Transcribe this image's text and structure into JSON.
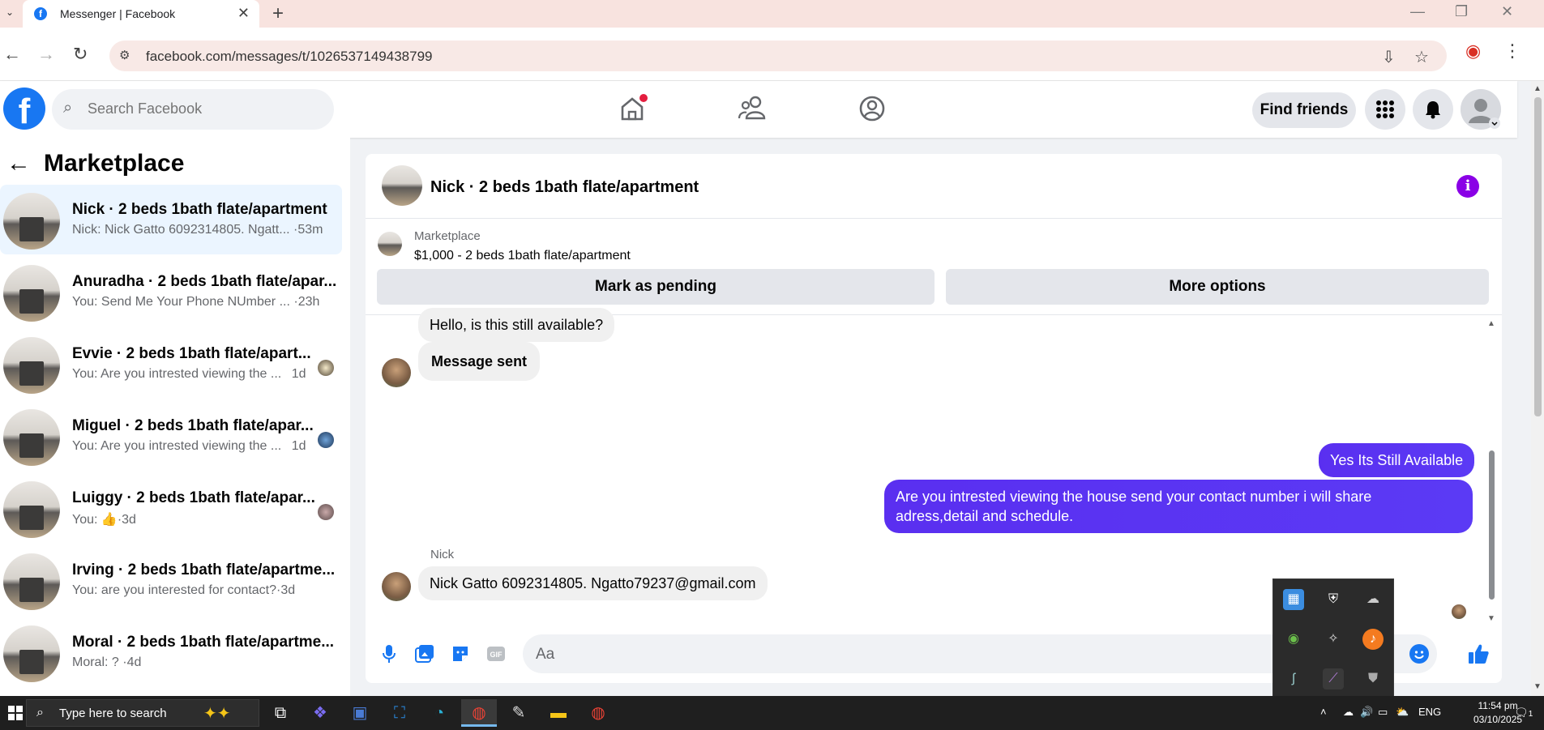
{
  "browser": {
    "tab_title": "Messenger | Facebook",
    "url": "facebook.com/messages/t/1026537149438799",
    "new_tab": "+",
    "close_tab": "✕"
  },
  "fb": {
    "search_placeholder": "Search Facebook",
    "find_friends": "Find friends",
    "colors": {
      "brand": "#1877f2",
      "outgoing_bubble": "#5b38f6",
      "info_accent": "#8a00e6"
    }
  },
  "sidebar": {
    "title": "Marketplace",
    "conversations": [
      {
        "name": "Nick · 2 beds 1bath flate/apartment",
        "preview": "Nick: Nick Gatto 6092314805. Ngatt...",
        "time": "·53m",
        "active": true
      },
      {
        "name": "Anuradha · 2 beds 1bath flate/apar...",
        "preview": "You: Send Me Your Phone NUmber ...",
        "time": "·23h",
        "active": false
      },
      {
        "name": "Evvie · 2 beds 1bath flate/apart...",
        "preview": "You: Are you intrested viewing the ...",
        "time": "1d",
        "active": false
      },
      {
        "name": "Miguel · 2 beds 1bath flate/apar...",
        "preview": "You: Are you intrested viewing the ...",
        "time": "1d",
        "active": false
      },
      {
        "name": "Luiggy · 2 beds 1bath flate/apar...",
        "preview": "You:",
        "time": "·3d",
        "active": false
      },
      {
        "name": "Irving · 2 beds 1bath flate/apartme...",
        "preview": "You: are you interested for contact?",
        "time": "·3d",
        "active": false
      },
      {
        "name": "Moral · 2 beds 1bath flate/apartme...",
        "preview": "Moral: ?",
        "time": "·4d",
        "active": false
      }
    ]
  },
  "chat": {
    "title": "Nick · 2 beds 1bath flate/apartment",
    "marketplace_label": "Marketplace",
    "listing": "$1,000 - 2 beds 1bath flate/apartment",
    "mark_pending": "Mark as pending",
    "more_options": "More options",
    "messages": {
      "m1": "Hello, is this still available?",
      "m2": "Message sent",
      "m3": "Yes Its Still Available",
      "m4_line1": "Are you intrested viewing the house send your contact number i will share",
      "m4_line2": "adress,detail and schedule.",
      "sender": "Nick",
      "m5": "Nick Gatto 6092314805.  Ngatto79237@gmail.com"
    },
    "composer_placeholder": "Aa"
  },
  "taskbar": {
    "search_text": "Type here to search",
    "lang": "ENG",
    "time": "11:54 pm",
    "date": "03/10/2025",
    "notif_count": "1"
  }
}
